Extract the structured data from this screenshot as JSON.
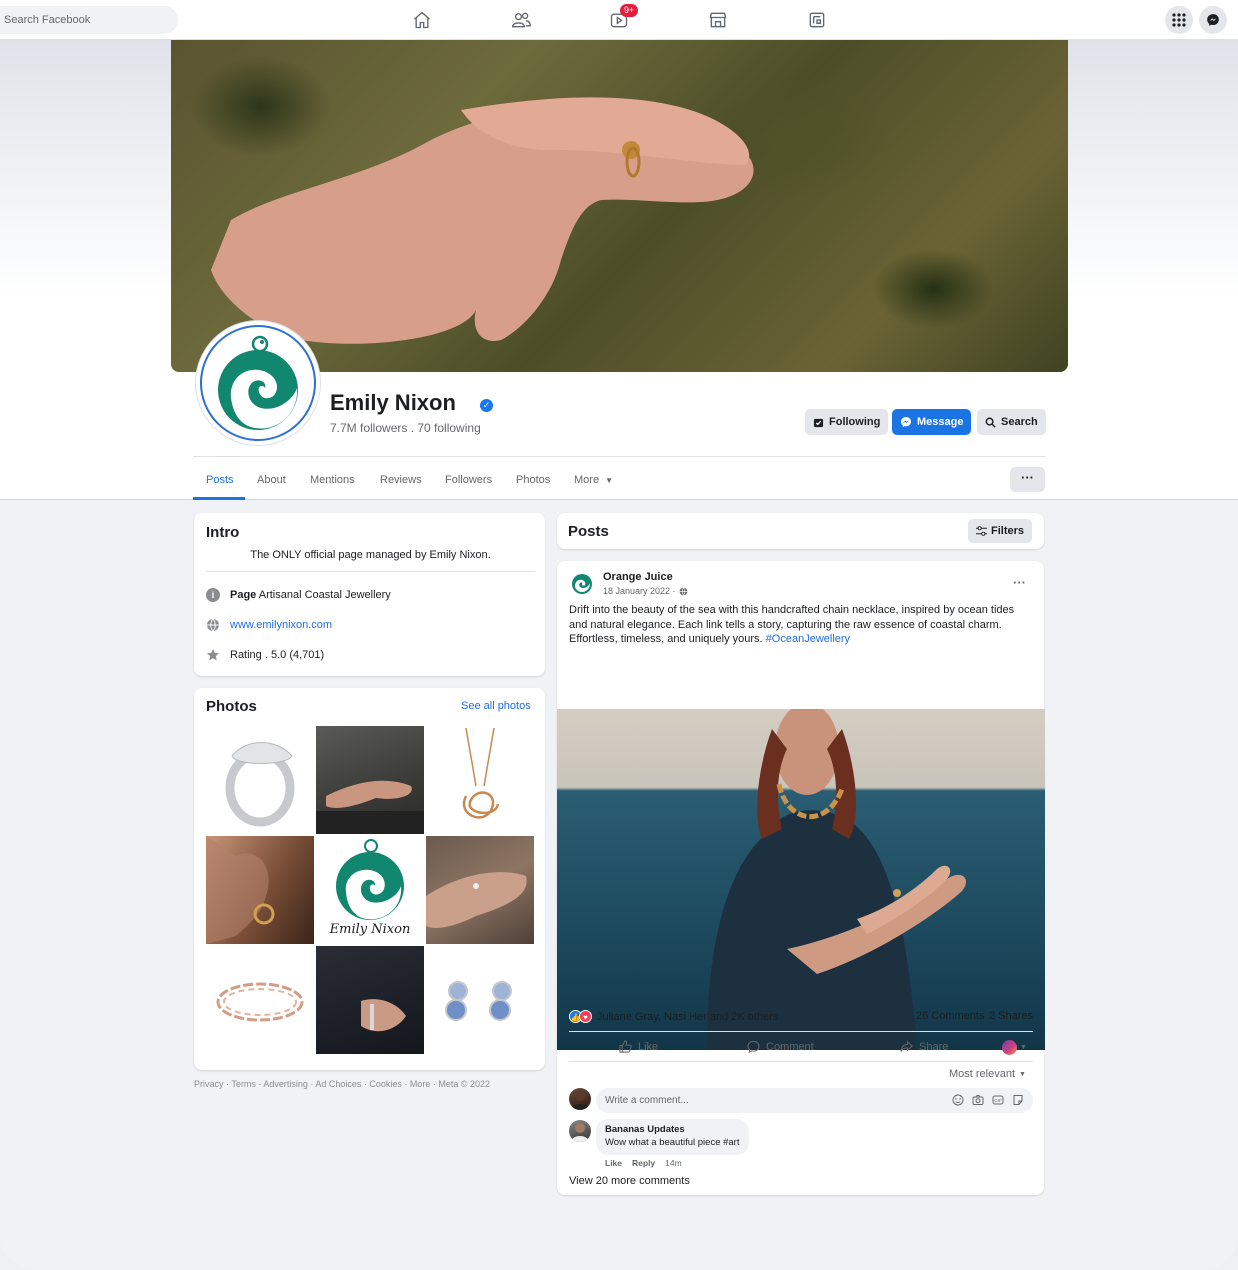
{
  "topbar": {
    "search_placeholder": "Search Facebook",
    "nav_icons": [
      "home-icon",
      "friends-icon",
      "watch-icon",
      "marketplace-icon",
      "gaming-icon"
    ],
    "watch_badge": "9+",
    "right_icons": [
      "apps-grid-icon",
      "messenger-icon"
    ]
  },
  "profile": {
    "name": "Emily Nixon",
    "followers_line": "7.7M followers . 70 following",
    "buttons": {
      "following": "Following",
      "message": "Message",
      "search": "Search"
    },
    "tabs": [
      "Posts",
      "About",
      "Mentions",
      "Reviews",
      "Followers",
      "Photos",
      "More"
    ],
    "active_tab": "Posts",
    "more_dots": "···"
  },
  "intro": {
    "title": "Intro",
    "bio": "The ONLY official page managed by Emily Nixon.",
    "page_label": "Page",
    "page_category": "Artisanal Coastal Jewellery",
    "website": "www.emilynixon.com",
    "rating": "Rating . 5.0 (4,701)"
  },
  "photos": {
    "title": "Photos",
    "see_all": "See all photos",
    "logo_text": "Emily Nixon"
  },
  "footer": "Privacy · Terms · Advertising · Ad Choices · Cookies · More · Meta © 2022",
  "posts_header": {
    "title": "Posts",
    "filters": "Filters"
  },
  "post": {
    "author": "Orange Juice",
    "date": "18 January 2022 ·",
    "text": "Drift into the beauty of the sea with this handcrafted chain necklace, inspired by ocean tides and natural elegance. Each link tells a story, capturing the raw essence of coastal charm. Effortless, timeless, and uniquely yours.",
    "hashtag": "#OceanJewellery",
    "reactions": "Juliane Gray, Nasi Her and 2K others",
    "comments_count": "26 Comments",
    "shares_count": "2 Shares",
    "actions": {
      "like": "Like",
      "comment": "Comment",
      "share": "Share"
    },
    "sort": "Most relevant",
    "write_comment": "Write a comment...",
    "comment": {
      "author": "Bananas Updates",
      "text": "Wow what a beautiful piece #art",
      "like": "Like",
      "reply": "Reply",
      "time": "14m"
    },
    "view_more": "View 20 more comments"
  },
  "colors": {
    "brand_blue": "#1b74e4",
    "logo_teal": "#12876f",
    "badge_red": "#e41e3f"
  }
}
